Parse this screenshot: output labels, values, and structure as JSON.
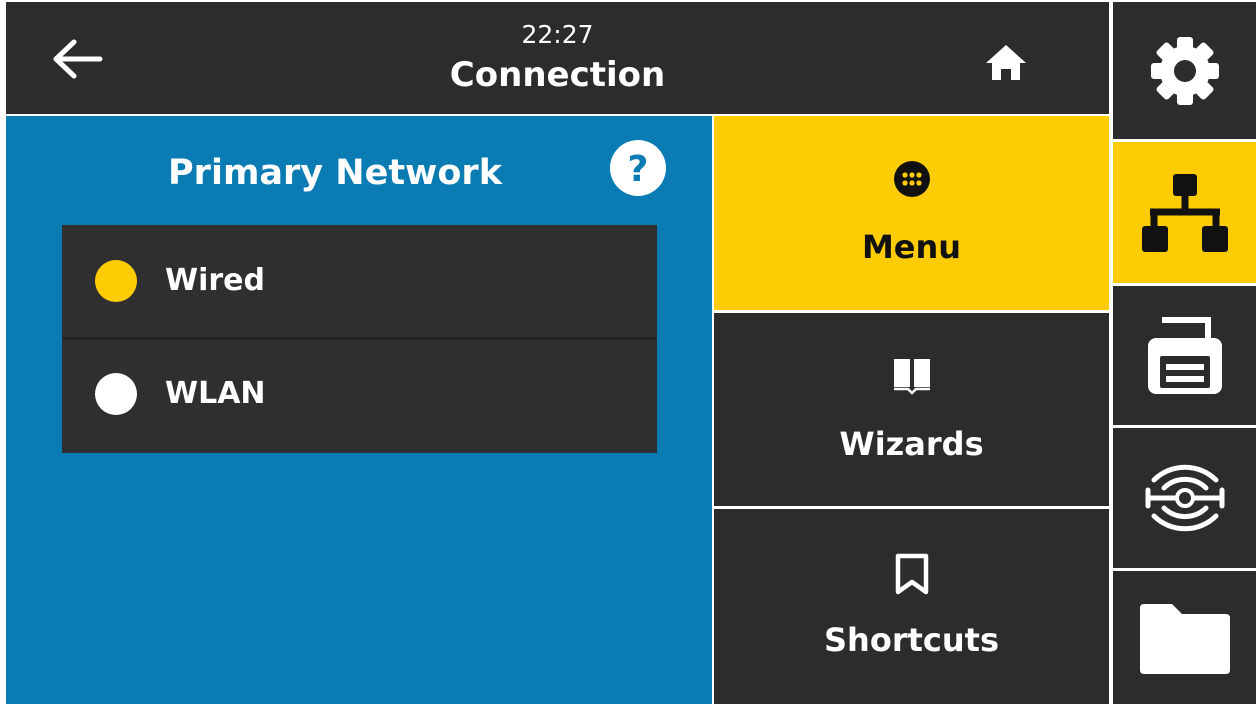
{
  "header": {
    "time": "22:27",
    "title": "Connection",
    "back_icon": "back-arrow-icon",
    "home_icon": "home-icon"
  },
  "panel": {
    "title": "Primary Network",
    "help_icon": "help-icon",
    "options": [
      {
        "label": "Wired",
        "selected": true
      },
      {
        "label": "WLAN",
        "selected": false
      }
    ]
  },
  "menu_tiles": [
    {
      "label": "Menu",
      "icon": "menu-dots-icon",
      "active": true
    },
    {
      "label": "Wizards",
      "icon": "book-icon",
      "active": false
    },
    {
      "label": "Shortcuts",
      "icon": "bookmark-icon",
      "active": false
    }
  ],
  "sidebar": [
    {
      "icon": "gear-icon",
      "active": false
    },
    {
      "icon": "network-icon",
      "active": true
    },
    {
      "icon": "printer-icon",
      "active": false
    },
    {
      "icon": "rfid-icon",
      "active": false
    },
    {
      "icon": "folder-icon",
      "active": false
    }
  ],
  "colors": {
    "accent_yellow": "#fecc05",
    "panel_blue": "#0a7bb3",
    "dark": "#2c2c2c",
    "radio_selected": "#fecc05",
    "radio_unselected": "#ffffff"
  }
}
